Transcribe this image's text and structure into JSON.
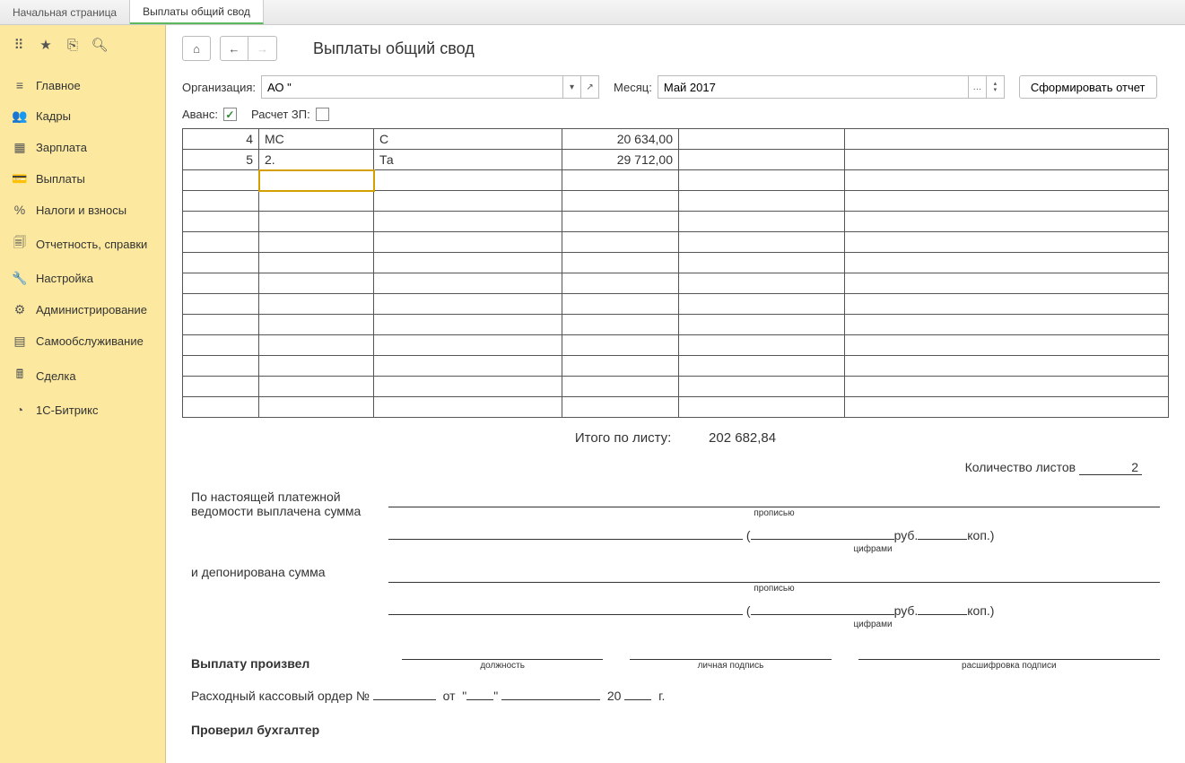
{
  "tabs": {
    "home": "Начальная страница",
    "active": "Выплаты общий свод"
  },
  "sidebar": {
    "items": [
      {
        "icon": "≡",
        "label": "Главное"
      },
      {
        "icon": "👥",
        "label": "Кадры"
      },
      {
        "icon": "▦",
        "label": "Зарплата"
      },
      {
        "icon": "💳",
        "label": "Выплаты"
      },
      {
        "icon": "%",
        "label": "Налоги и взносы"
      },
      {
        "icon": "🗐",
        "label": "Отчетность, справки"
      },
      {
        "icon": "🔧",
        "label": "Настройка"
      },
      {
        "icon": "⚙",
        "label": "Администрирование"
      },
      {
        "icon": "▤",
        "label": "Самообслуживание"
      },
      {
        "icon": "🖩",
        "label": "Сделка"
      },
      {
        "icon": "◔",
        "label": "1С-Битрикс"
      }
    ]
  },
  "page": {
    "title": "Выплаты общий свод"
  },
  "filters": {
    "org_label": "Организация:",
    "org_value": "АО \"",
    "month_label": "Месяц:",
    "month_value": "Май 2017",
    "generate_btn": "Сформировать отчет",
    "advance_label": "Аванс:",
    "advance_checked": true,
    "calc_label": "Расчет ЗП:",
    "calc_checked": false
  },
  "table": {
    "rows": [
      {
        "num": "4",
        "code": "МС",
        "name": "С",
        "amount": "20 634,00"
      },
      {
        "num": "5",
        "code": "2.",
        "name": "Та",
        "amount": "29 712,00"
      }
    ]
  },
  "doc": {
    "total_label": "Итого по листу:",
    "total_value": "202 682,84",
    "sheets_label": "Количество листов",
    "sheets_value": "2",
    "paid_label": "По настоящей платежной ведомости выплачена сумма",
    "propisyu": "прописью",
    "rub": " руб.",
    "kop": " коп.)",
    "tsiframi": "цифрами",
    "deposited_label": "и депонирована сумма",
    "performed_label": "Выплату произвел",
    "position": "должность",
    "signature": "личная подпись",
    "decryption": "расшифровка подписи",
    "order_label": "Расходный кассовый ордер №",
    "order_from": "от",
    "order_year_suffix": "20",
    "order_g": "г.",
    "checked_label": "Проверил бухгалтер"
  }
}
